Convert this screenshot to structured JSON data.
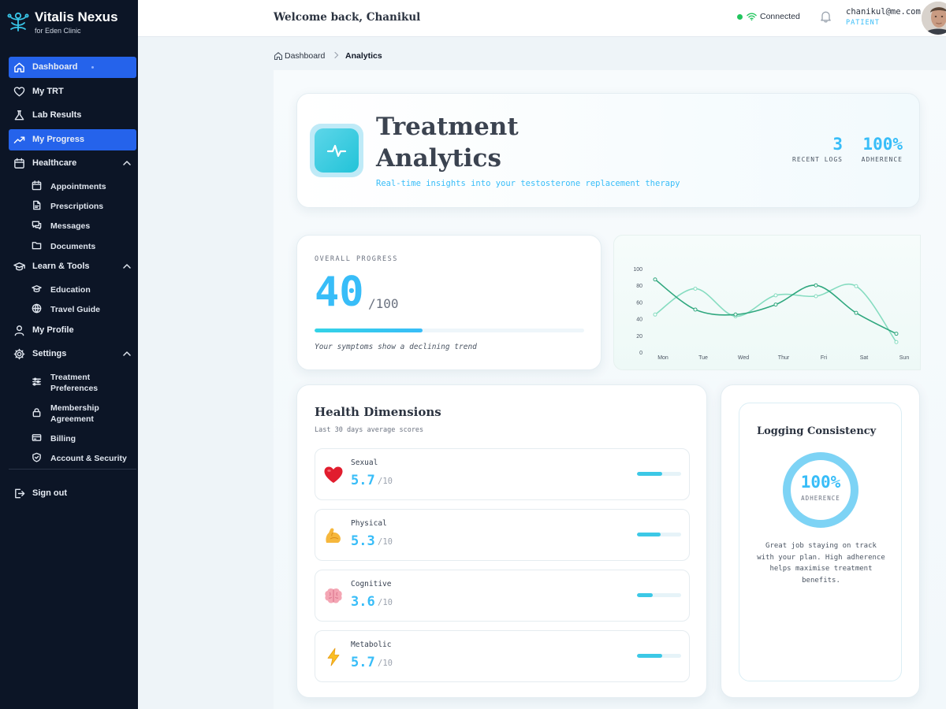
{
  "brand": {
    "name": "Vitalis Nexus",
    "subtitle": "for Eden Clinic"
  },
  "sidebar": {
    "items": [
      {
        "label": "Dashboard",
        "icon": "home-icon"
      },
      {
        "label": "My TRT",
        "icon": "heart-icon"
      },
      {
        "label": "Lab Results",
        "icon": "flask-icon"
      },
      {
        "label": "My Progress",
        "icon": "trending-up-icon"
      },
      {
        "label": "Healthcare",
        "icon": "calendar-icon"
      },
      {
        "label": "Learn & Tools",
        "icon": "graduation-cap-icon"
      },
      {
        "label": "My Profile",
        "icon": "user-icon"
      },
      {
        "label": "Settings",
        "icon": "gear-icon"
      },
      {
        "label": "Sign out",
        "icon": "logout-icon"
      }
    ],
    "healthcare_sub": [
      "Appointments",
      "Prescriptions",
      "Messages",
      "Documents"
    ],
    "learn_sub": [
      "Education",
      "Travel Guide"
    ],
    "settings_sub": [
      "Treatment Preferences",
      "Membership Agreement",
      "Billing",
      "Account & Security"
    ]
  },
  "topbar": {
    "welcome": "Welcome back, Chanikul",
    "connection": "Connected",
    "email": "chanikul@me.com",
    "role": "PATIENT"
  },
  "breadcrumb": {
    "home": "Dashboard",
    "current": "Analytics"
  },
  "hero": {
    "title": "Treatment Analytics",
    "subtitle": "Real-time insights into your testosterone replacement therapy",
    "stats": [
      {
        "value": "3",
        "label": "RECENT LOGS"
      },
      {
        "value": "100%",
        "label": "ADHERENCE"
      }
    ]
  },
  "progress": {
    "label": "OVERALL PROGRESS",
    "value": "40",
    "max": "/100",
    "fraction": 0.4,
    "note": "Your symptoms show a declining trend"
  },
  "chart_data": {
    "type": "line",
    "categories": [
      "Mon",
      "Tue",
      "Wed",
      "Thur",
      "Fri",
      "Sat",
      "Sun"
    ],
    "yticks": [
      0,
      20,
      40,
      60,
      80,
      100
    ],
    "ylim": [
      0,
      100
    ],
    "series": [
      {
        "color": "#2fa77e",
        "values": [
          87,
          51,
          45,
          57,
          80,
          47,
          22
        ]
      },
      {
        "color": "#86dcc0",
        "values": [
          45,
          76,
          43,
          68,
          67,
          79,
          12
        ]
      }
    ]
  },
  "health": {
    "title": "Health Dimensions",
    "subtitle": "Last 30 days average scores",
    "dimensions": [
      {
        "name": "Sexual",
        "score": "5.7",
        "max": "/10",
        "emoji": "❤️",
        "icon": "heart-emoji",
        "fraction": 0.57
      },
      {
        "name": "Physical",
        "score": "5.3",
        "max": "/10",
        "emoji": "💪",
        "icon": "flexed-biceps-emoji",
        "fraction": 0.53
      },
      {
        "name": "Cognitive",
        "score": "3.6",
        "max": "/10",
        "emoji": "🧠",
        "icon": "brain-emoji",
        "fraction": 0.36
      },
      {
        "name": "Metabolic",
        "score": "5.7",
        "max": "/10",
        "emoji": "⚡",
        "icon": "lightning-emoji",
        "fraction": 0.57
      }
    ]
  },
  "consistency": {
    "title": "Logging Consistency",
    "value": "100%",
    "label": "ADHERENCE",
    "fraction": 1.0,
    "message": "Great job staying on track with your plan. High adherence helps maximise treatment benefits."
  },
  "colors": {
    "accent": "#38bdf8",
    "active_nav": "#2563eb",
    "sidebar_bg": "#0c1526",
    "status_ok": "#22c55e"
  }
}
